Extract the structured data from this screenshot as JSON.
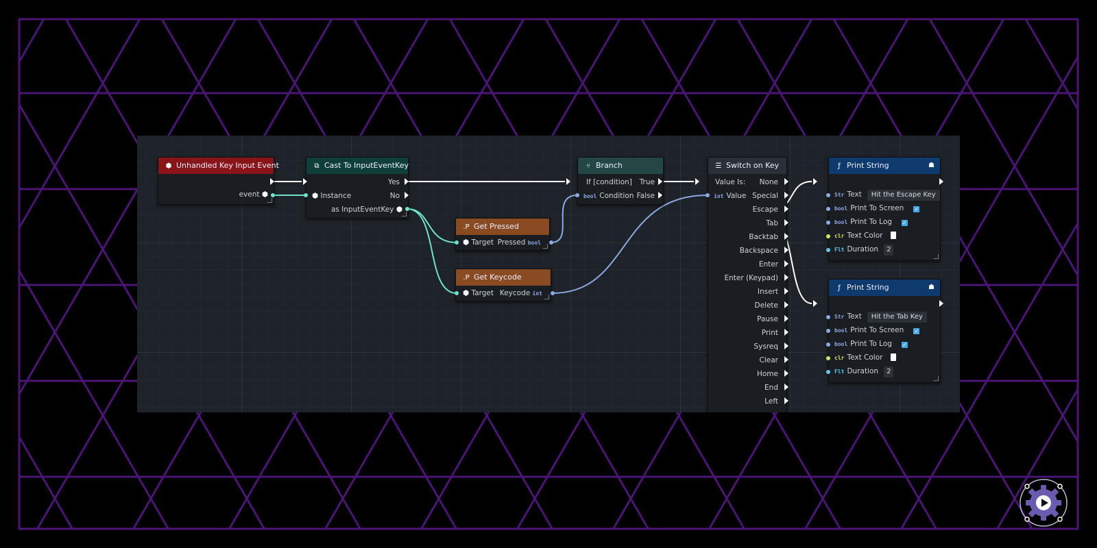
{
  "colors": {
    "accent_purple": "#5a1a8a",
    "exec_wire": "#ffffff",
    "object_wire": "#6fe3c9",
    "bool_wire": "#8fa8e6"
  },
  "nodes": {
    "unhandled": {
      "title": "Unhandled Key Input Event",
      "icon": "object-icon",
      "event_label": "event"
    },
    "cast": {
      "title": "Cast To InputEventKey",
      "icon": "cast-icon",
      "yes": "Yes",
      "instance": "Instance",
      "no": "No",
      "as_label": "as InputEventKey"
    },
    "get_pressed": {
      "title": "Get Pressed",
      "icon": "property-icon",
      "target": "Target",
      "pressed": "Pressed",
      "pressed_type": "bool"
    },
    "get_keycode": {
      "title": "Get Keycode",
      "icon": "property-icon",
      "target": "Target",
      "keycode": "Keycode",
      "keycode_type": "int"
    },
    "branch": {
      "title": "Branch",
      "icon": "branch-icon",
      "if_label": "If [condition]",
      "true_label": "True",
      "condition_type": "bool",
      "condition": "Condition",
      "false_label": "False"
    },
    "switch": {
      "title": "Switch on Key",
      "icon": "switch-icon",
      "value_is": "Value Is:",
      "value_type": "int",
      "value": "Value",
      "cases": [
        "None",
        "Special",
        "Escape",
        "Tab",
        "Backtab",
        "Backspace",
        "Enter",
        "Enter (Keypad)",
        "Insert",
        "Delete",
        "Pause",
        "Print",
        "Sysreq",
        "Clear",
        "Home",
        "End",
        "Left"
      ]
    },
    "print1": {
      "title": "Print String",
      "icon": "function-icon",
      "text_type": "Str",
      "text_label": "Text",
      "text_value": "Hit the Escape Key",
      "bool_type": "bool",
      "print_screen": "Print To Screen",
      "print_log": "Print To Log",
      "color_type": "clr",
      "text_color": "Text Color",
      "float_type": "Flt",
      "duration": "Duration",
      "duration_value": "2"
    },
    "print2": {
      "title": "Print String",
      "icon": "function-icon",
      "text_type": "Str",
      "text_label": "Text",
      "text_value": "Hit the Tab Key",
      "bool_type": "bool",
      "print_screen": "Print To Screen",
      "print_log": "Print To Log",
      "color_type": "clr",
      "text_color": "Text Color",
      "float_type": "Flt",
      "duration": "Duration",
      "duration_value": "2"
    }
  }
}
